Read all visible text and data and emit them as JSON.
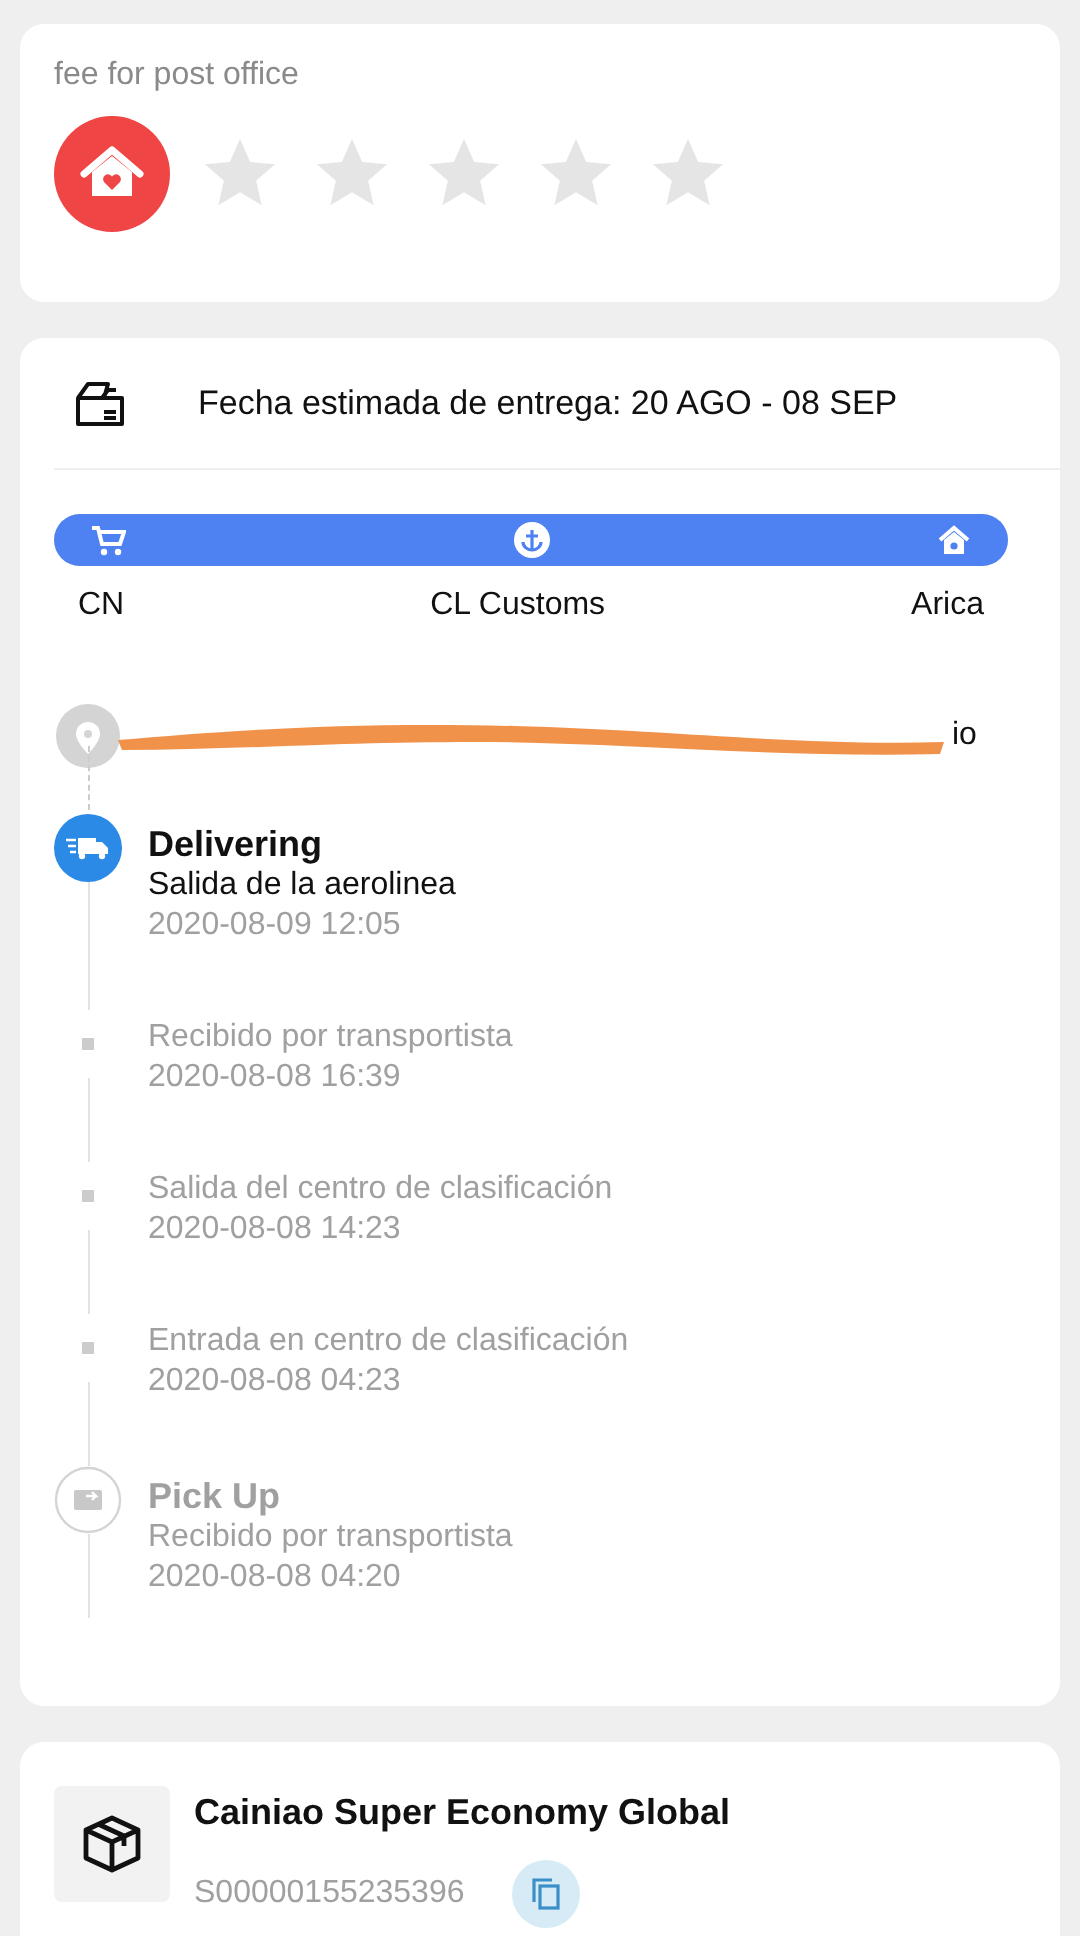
{
  "rating": {
    "label": "fee for post office",
    "stars": 0
  },
  "delivery": {
    "estimate": "Fecha estimada de entrega: 20 AGO - 08 SEP",
    "route": {
      "level": 1,
      "stops": [
        "CN",
        "CL Customs",
        "Arica"
      ]
    },
    "address": "io",
    "events": [
      {
        "kind": "main",
        "title": "Delivering",
        "text": "Salida de la aerolinea",
        "time": "2020-08-09 12:05"
      },
      {
        "kind": "minor",
        "text": "Recibido por transportista",
        "time": "2020-08-08 16:39"
      },
      {
        "kind": "minor",
        "text": "Salida del centro de clasificación",
        "time": "2020-08-08 14:23"
      },
      {
        "kind": "minor",
        "text": "Entrada en centro de clasificación",
        "time": "2020-08-08 04:23"
      },
      {
        "kind": "origin",
        "title": "Pick Up",
        "text": "Recibido por transportista",
        "time": "2020-08-08 04:20"
      }
    ]
  },
  "carrier": {
    "name": "Cainiao Super Economy Global",
    "tracking": "S00000155235396"
  }
}
